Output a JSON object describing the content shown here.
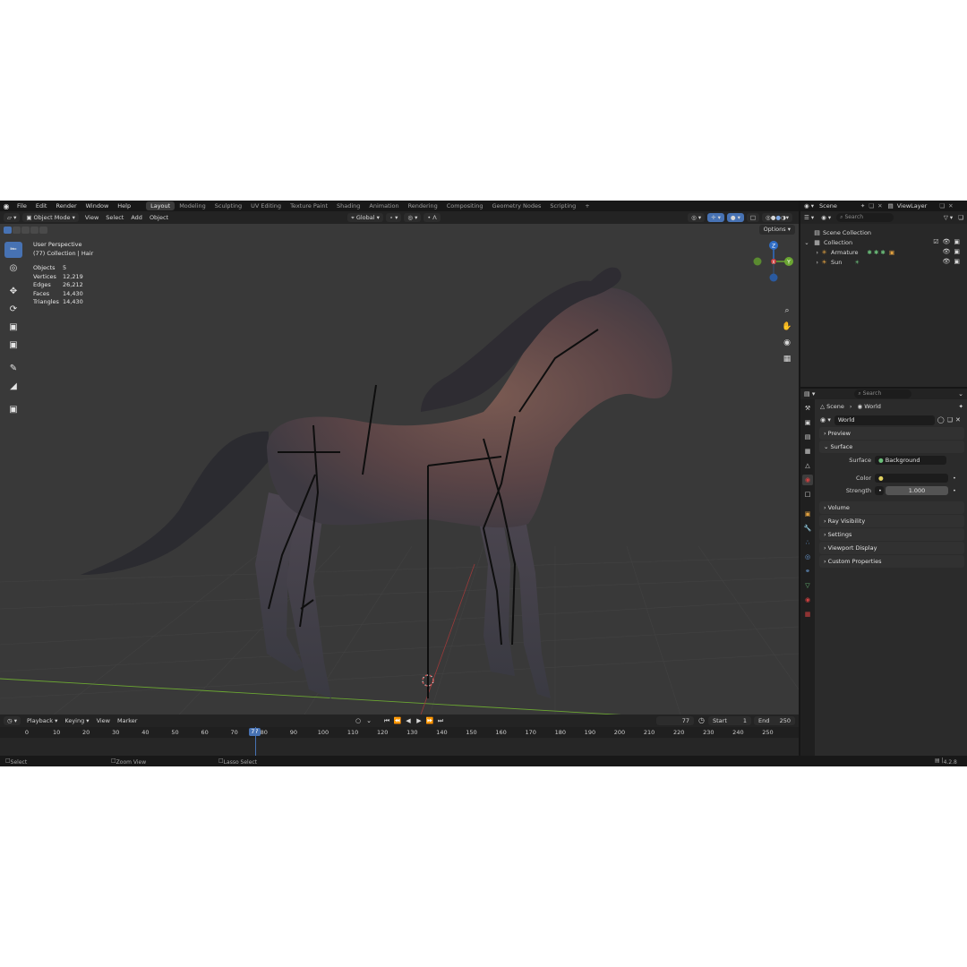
{
  "menu": {
    "items": [
      "File",
      "Edit",
      "Render",
      "Window",
      "Help"
    ]
  },
  "workspaces": [
    "Layout",
    "Modeling",
    "Sculpting",
    "UV Editing",
    "Texture Paint",
    "Shading",
    "Animation",
    "Rendering",
    "Compositing",
    "Geometry Nodes",
    "Scripting"
  ],
  "workspace_add": "+",
  "viewport_header": {
    "mode": "Object Mode",
    "menus": [
      "View",
      "Select",
      "Add",
      "Object"
    ],
    "transform_orientation": "Global",
    "options": "Options"
  },
  "viewport": {
    "perspective": "User Perspective",
    "context": "(77) Collection | Hair",
    "stats": [
      {
        "label": "Objects",
        "value": "5"
      },
      {
        "label": "Vertices",
        "value": "12,219"
      },
      {
        "label": "Edges",
        "value": "26,212"
      },
      {
        "label": "Faces",
        "value": "14,430"
      },
      {
        "label": "Triangles",
        "value": "14,430"
      }
    ],
    "gizmo": {
      "z": "Z",
      "y": "Y",
      "x": "X"
    }
  },
  "timeline": {
    "menus": [
      "Playback",
      "Keying",
      "View",
      "Marker"
    ],
    "current_frame": "77",
    "start_label": "Start",
    "start_value": "1",
    "end_label": "End",
    "end_value": "250",
    "ticks": [
      "0",
      "10",
      "20",
      "30",
      "40",
      "50",
      "60",
      "70",
      "80",
      "90",
      "100",
      "110",
      "120",
      "130",
      "140",
      "150",
      "160",
      "170",
      "180",
      "190",
      "200",
      "210",
      "220",
      "230",
      "240",
      "250"
    ]
  },
  "statusbar": {
    "select": "Select",
    "zoom": "Zoom View",
    "lasso": "Lasso Select",
    "version": "4.2.8"
  },
  "outliner": {
    "scene": "Scene",
    "view_layer": "ViewLayer",
    "search_placeholder": "Search",
    "root": "Scene Collection",
    "collection": "Collection",
    "items": [
      "Armature",
      "Sun"
    ]
  },
  "properties": {
    "search_placeholder": "Search",
    "breadcrumb_scene": "Scene",
    "breadcrumb_world": "World",
    "world_name": "World",
    "panels_top": [
      "Preview",
      "Surface"
    ],
    "surface_label": "Surface",
    "surface_value": "Background",
    "color_label": "Color",
    "strength_label": "Strength",
    "strength_value": "1.000",
    "panels_bottom": [
      "Volume",
      "Ray Visibility",
      "Settings",
      "Viewport Display",
      "Custom Properties"
    ]
  },
  "colors": {
    "accent": "#4772b3",
    "viewport_bg": "#393939",
    "x_axis": "#c93a3a",
    "y_axis": "#6ba632",
    "z_axis": "#2f6dc6"
  }
}
